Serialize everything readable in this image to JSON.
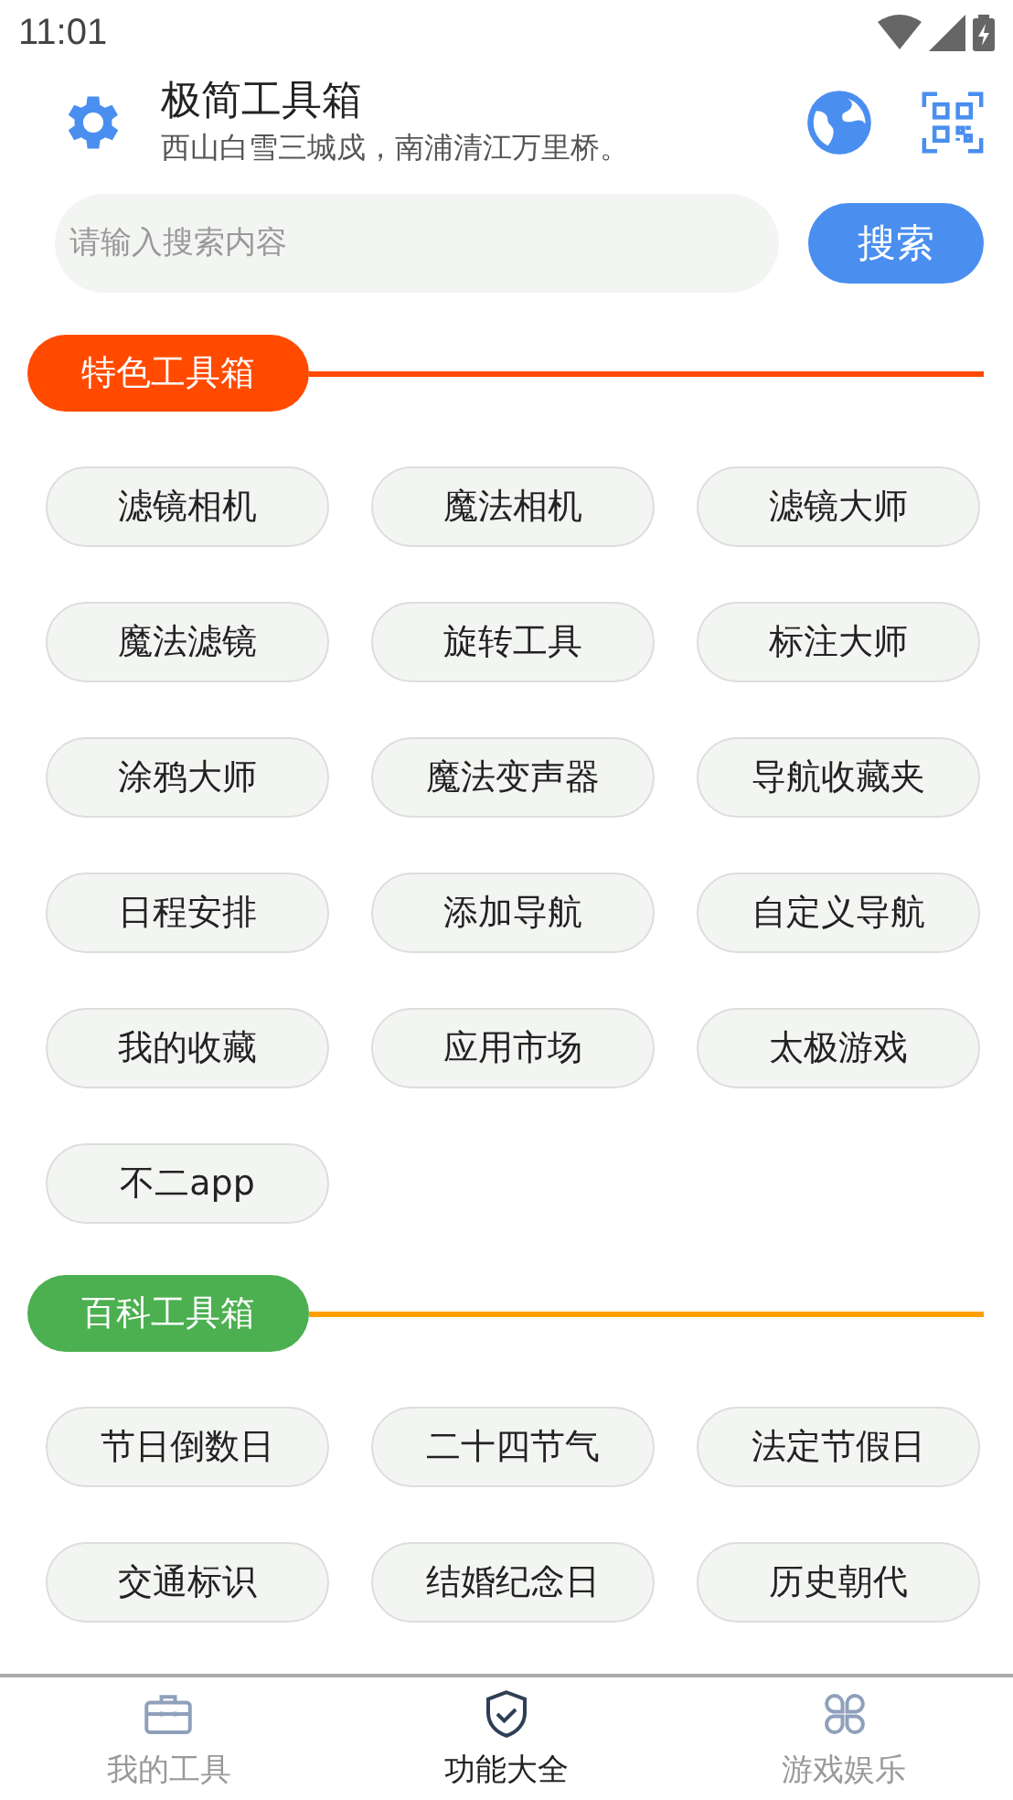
{
  "status_bar": {
    "time": "11:01"
  },
  "header": {
    "title": "极简工具箱",
    "subtitle": "西山白雪三城戍，南浦清江万里桥。"
  },
  "search": {
    "placeholder": "请输入搜索内容",
    "button": "搜索"
  },
  "sections": [
    {
      "title": "特色工具箱",
      "color": "#ff4a00",
      "line": {
        "color": "#ff4a00"
      },
      "items": [
        "滤镜相机",
        "魔法相机",
        "滤镜大师",
        "魔法滤镜",
        "旋转工具",
        "标注大师",
        "涂鸦大师",
        "魔法变声器",
        "导航收藏夹",
        "日程安排",
        "添加导航",
        "自定义导航",
        "我的收藏",
        "应用市场",
        "太极游戏",
        "不二app"
      ]
    },
    {
      "title": "百科工具箱",
      "color": "#4caf50",
      "line": {
        "color": "#ff9f00"
      },
      "items": [
        "节日倒数日",
        "二十四节气",
        "法定节假日",
        "交通标识",
        "结婚纪念日",
        "历史朝代"
      ]
    }
  ],
  "bottom_nav": [
    {
      "label": "我的工具",
      "kind": "toolbox",
      "selected": false
    },
    {
      "label": "功能大全",
      "kind": "shield",
      "selected": true
    },
    {
      "label": "游戏娱乐",
      "kind": "clover",
      "selected": false
    }
  ]
}
